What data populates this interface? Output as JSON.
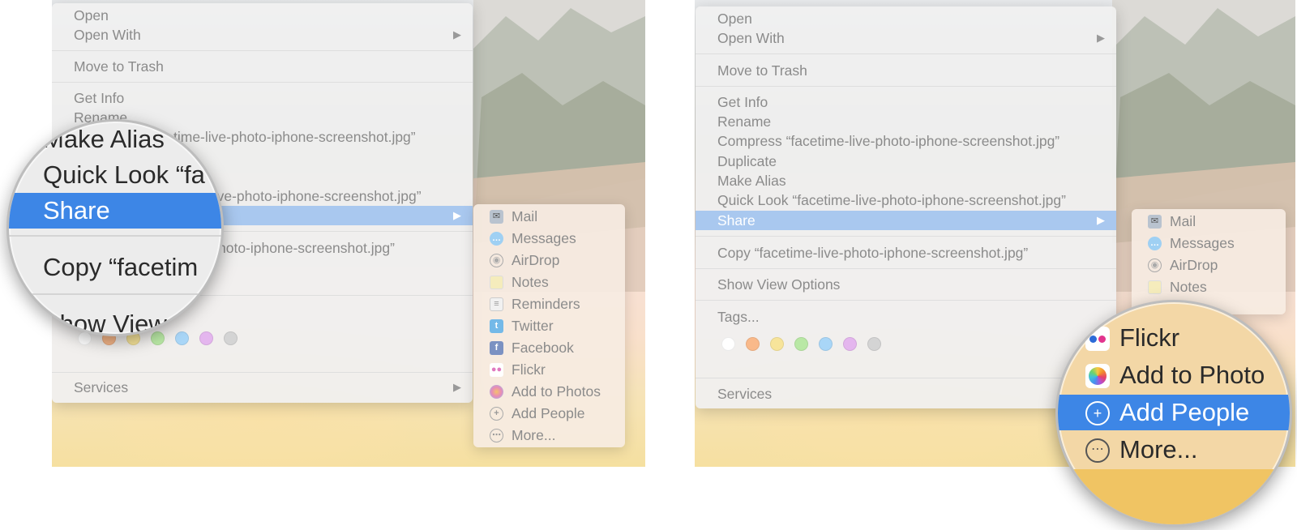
{
  "left": {
    "menu": {
      "items": [
        {
          "label": "Open"
        },
        {
          "label": "Open With"
        },
        {
          "label": "Move to Trash"
        },
        {
          "label": "Get Info"
        },
        {
          "label": "Rename"
        },
        {
          "label": "time-live-photo-iphone-screenshot.jpg”"
        },
        {
          "label": "-live-photo-iphone-screenshot.jpg”"
        },
        {
          "label": "hoto-iphone-screenshot.jpg”"
        },
        {
          "label": "Services"
        }
      ]
    },
    "magnifier": {
      "rows": [
        "Make Alias",
        "Quick Look “fa",
        "Share",
        "Copy “facetim",
        "Show View"
      ]
    },
    "submenu": {
      "items": [
        {
          "label": "Mail",
          "icon": "mail-icon"
        },
        {
          "label": "Messages",
          "icon": "messages-icon"
        },
        {
          "label": "AirDrop",
          "icon": "airdrop-icon"
        },
        {
          "label": "Notes",
          "icon": "notes-icon"
        },
        {
          "label": "Reminders",
          "icon": "reminders-icon"
        },
        {
          "label": "Twitter",
          "icon": "twitter-icon"
        },
        {
          "label": "Facebook",
          "icon": "facebook-icon"
        },
        {
          "label": "Flickr",
          "icon": "flickr-icon"
        },
        {
          "label": "Add to Photos",
          "icon": "photos-icon"
        },
        {
          "label": "Add People",
          "icon": "add-people-icon"
        },
        {
          "label": "More...",
          "icon": "more-icon"
        }
      ]
    }
  },
  "right": {
    "menu": {
      "items": [
        {
          "label": "Open"
        },
        {
          "label": "Open With"
        },
        {
          "label": "Move to Trash"
        },
        {
          "label": "Get Info"
        },
        {
          "label": "Rename"
        },
        {
          "label": "Compress “facetime-live-photo-iphone-screenshot.jpg”"
        },
        {
          "label": "Duplicate"
        },
        {
          "label": "Make Alias"
        },
        {
          "label": "Quick Look “facetime-live-photo-iphone-screenshot.jpg”"
        },
        {
          "label": "Share"
        },
        {
          "label": "Copy “facetime-live-photo-iphone-screenshot.jpg”"
        },
        {
          "label": "Show View Options"
        },
        {
          "label": "Tags..."
        },
        {
          "label": "Services"
        }
      ]
    },
    "submenu": {
      "items": [
        {
          "label": "Mail",
          "icon": "mail-icon"
        },
        {
          "label": "Messages",
          "icon": "messages-icon"
        },
        {
          "label": "AirDrop",
          "icon": "airdrop-icon"
        },
        {
          "label": "Notes",
          "icon": "notes-icon"
        }
      ]
    },
    "magnifier": {
      "rows": [
        "Flickr",
        "Add to Photo",
        "Add People",
        "More..."
      ]
    }
  },
  "tag_colors": [
    "#ffffff",
    "#f9b98a",
    "#f7e49a",
    "#b9e8a5",
    "#a9d6f7",
    "#e4b6ee",
    "#d4d4d4"
  ],
  "colors": {
    "highlight_light": "#a9c8ef",
    "highlight_strong": "#3d86e6"
  }
}
